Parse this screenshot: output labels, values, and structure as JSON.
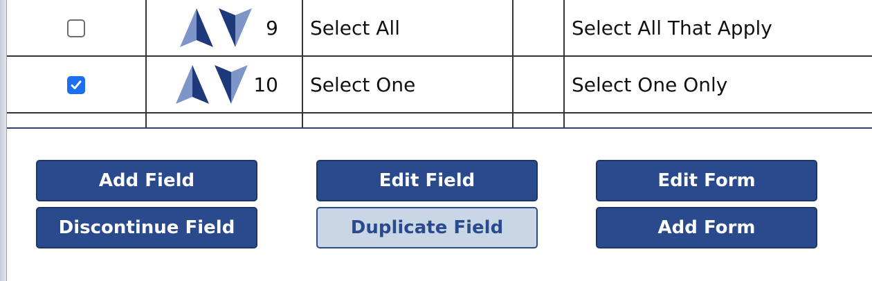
{
  "table": {
    "rows": [
      {
        "checked": false,
        "order": "9",
        "name": "Select All",
        "col4": "",
        "label": "Select All That Apply"
      },
      {
        "checked": true,
        "order": "10",
        "name": "Select One",
        "col4": "",
        "label": "Select One Only"
      }
    ]
  },
  "icons": {
    "move_up": "arrow-up-icon",
    "move_down": "arrow-down-icon"
  },
  "buttons": {
    "add_field": "Add Field",
    "edit_field": "Edit Field",
    "edit_form": "Edit Form",
    "discontinue_field": "Discontinue Field",
    "duplicate_field": "Duplicate Field",
    "add_form": "Add Form"
  },
  "colors": {
    "button_bg": "#2b4a8e",
    "button_light_bg": "#c8d6e6",
    "checkbox_checked": "#1b6ff0",
    "arrow_dark": "#1f3a7a",
    "arrow_light": "#7e95c8"
  }
}
